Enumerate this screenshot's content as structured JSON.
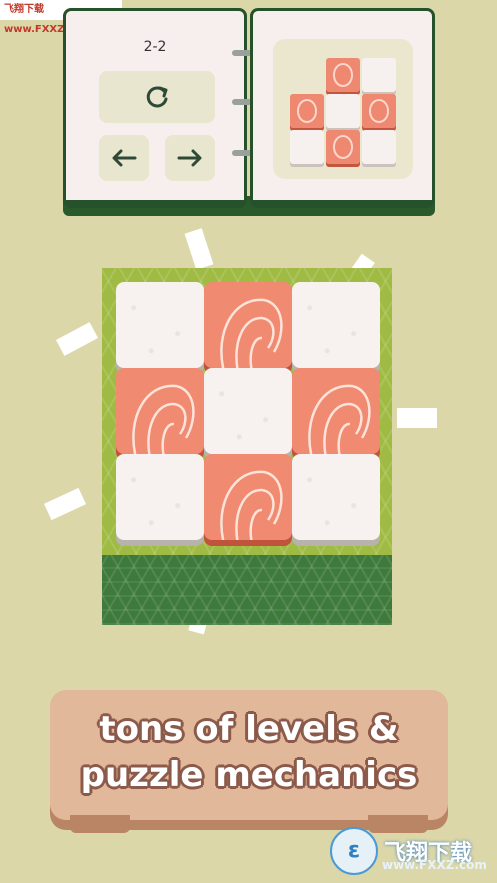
{
  "watermark_top": "飞翔下载 www.FXXZ.com",
  "book": {
    "level": "2-2",
    "restart_icon": "restart-icon",
    "prev_icon": "arrow-left-icon",
    "next_icon": "arrow-right-icon",
    "preview_pattern": [
      [
        "empty",
        "salmon",
        "rice"
      ],
      [
        "salmon",
        "rice",
        "salmon"
      ],
      [
        "rice",
        "salmon",
        "rice"
      ]
    ]
  },
  "board": {
    "tiles": [
      [
        "rice",
        "salmon",
        "rice"
      ],
      [
        "salmon",
        "rice",
        "salmon"
      ],
      [
        "rice",
        "salmon",
        "rice"
      ]
    ]
  },
  "slogan": {
    "line1": "tons of levels &",
    "line2": "puzzle mechanics"
  },
  "watermark_bottom": {
    "title": "飞翔下载",
    "url": "www.FXXZ.com"
  },
  "colors": {
    "background": "#dcd7a8",
    "salmon": "#f08a70",
    "rice": "#f7f1ef",
    "frame_green": "#9fbb44",
    "dark_green": "#3e7a3b",
    "wood": "#e2b89a"
  }
}
